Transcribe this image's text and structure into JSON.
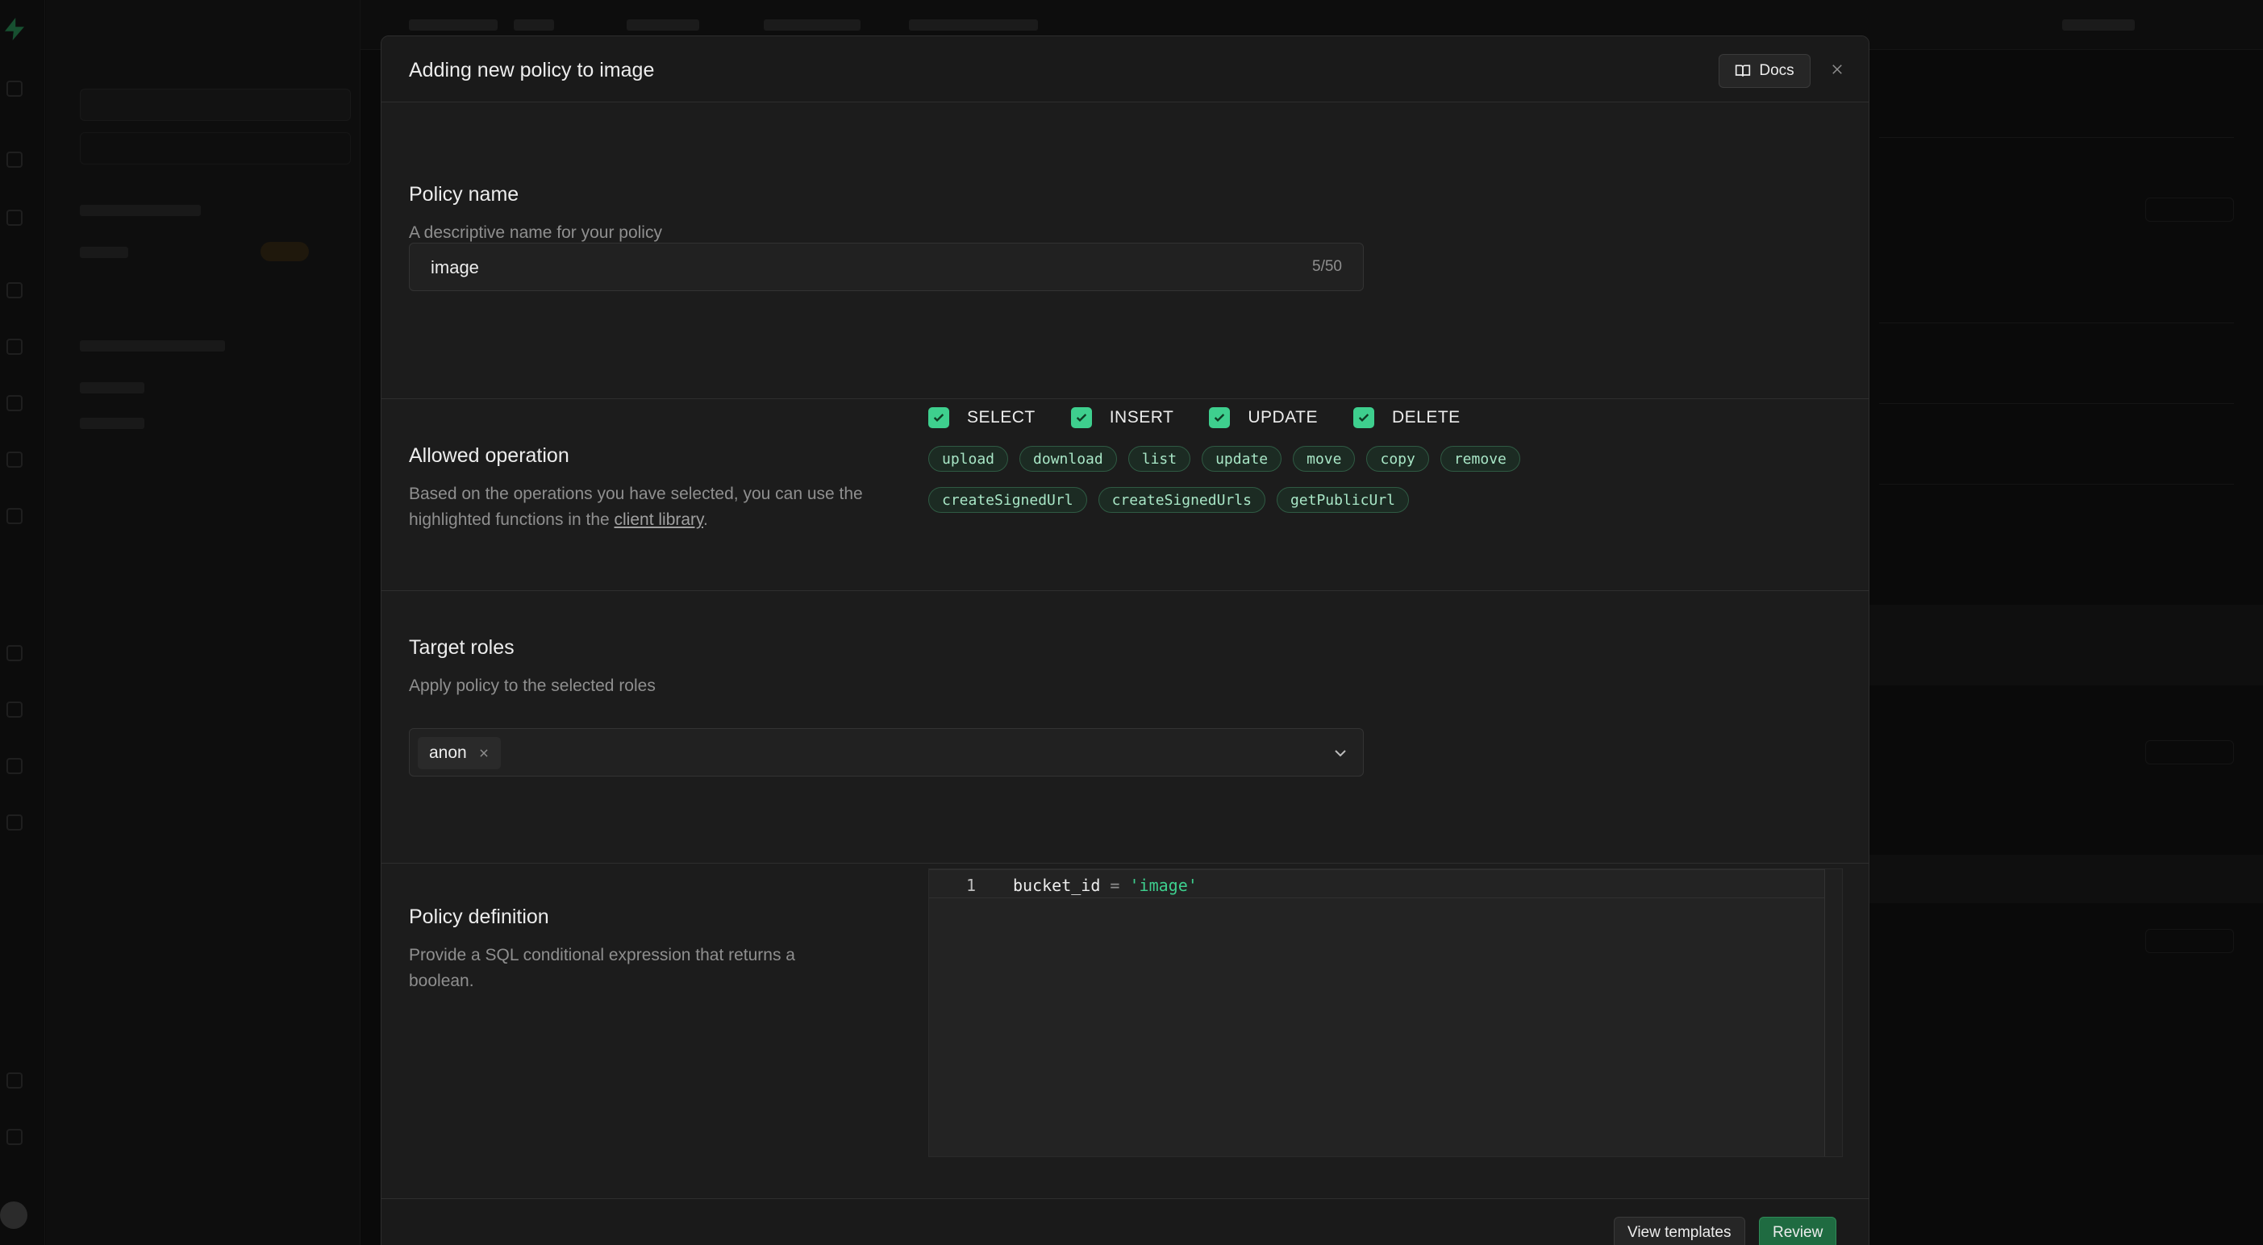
{
  "modal": {
    "title": "Adding new policy to image",
    "docs_label": "Docs"
  },
  "policy_name": {
    "title": "Policy name",
    "description": "A descriptive name for your policy",
    "value": "image",
    "char_count": "5/50"
  },
  "allowed_operation": {
    "title": "Allowed operation",
    "description_prefix": "Based on the operations you have selected, you can use the highlighted functions in the ",
    "link_text": "client library",
    "description_suffix": ".",
    "operations": [
      {
        "label": "SELECT",
        "checked": true
      },
      {
        "label": "INSERT",
        "checked": true
      },
      {
        "label": "UPDATE",
        "checked": true
      },
      {
        "label": "DELETE",
        "checked": true
      }
    ],
    "functions_row1": [
      "upload",
      "download",
      "list",
      "update",
      "move",
      "copy",
      "remove"
    ],
    "functions_row2": [
      "createSignedUrl",
      "createSignedUrls",
      "getPublicUrl"
    ]
  },
  "target_roles": {
    "title": "Target roles",
    "description": "Apply policy to the selected roles",
    "selected": [
      "anon"
    ]
  },
  "policy_definition": {
    "title": "Policy definition",
    "description": "Provide a SQL conditional expression that returns a boolean.",
    "line_number": "1",
    "code_lhs": "bucket_id",
    "code_op": "=",
    "code_rhs": "'image'"
  },
  "footer": {
    "view_templates_label": "View templates",
    "review_label": "Review"
  },
  "colors": {
    "accent": "#3ecf8e",
    "primary_button": "#1f6b41",
    "background": "#1c1c1c"
  },
  "icons": [
    "book-icon",
    "close-icon",
    "check-icon",
    "chevron-down-icon",
    "chip-remove-icon"
  ]
}
